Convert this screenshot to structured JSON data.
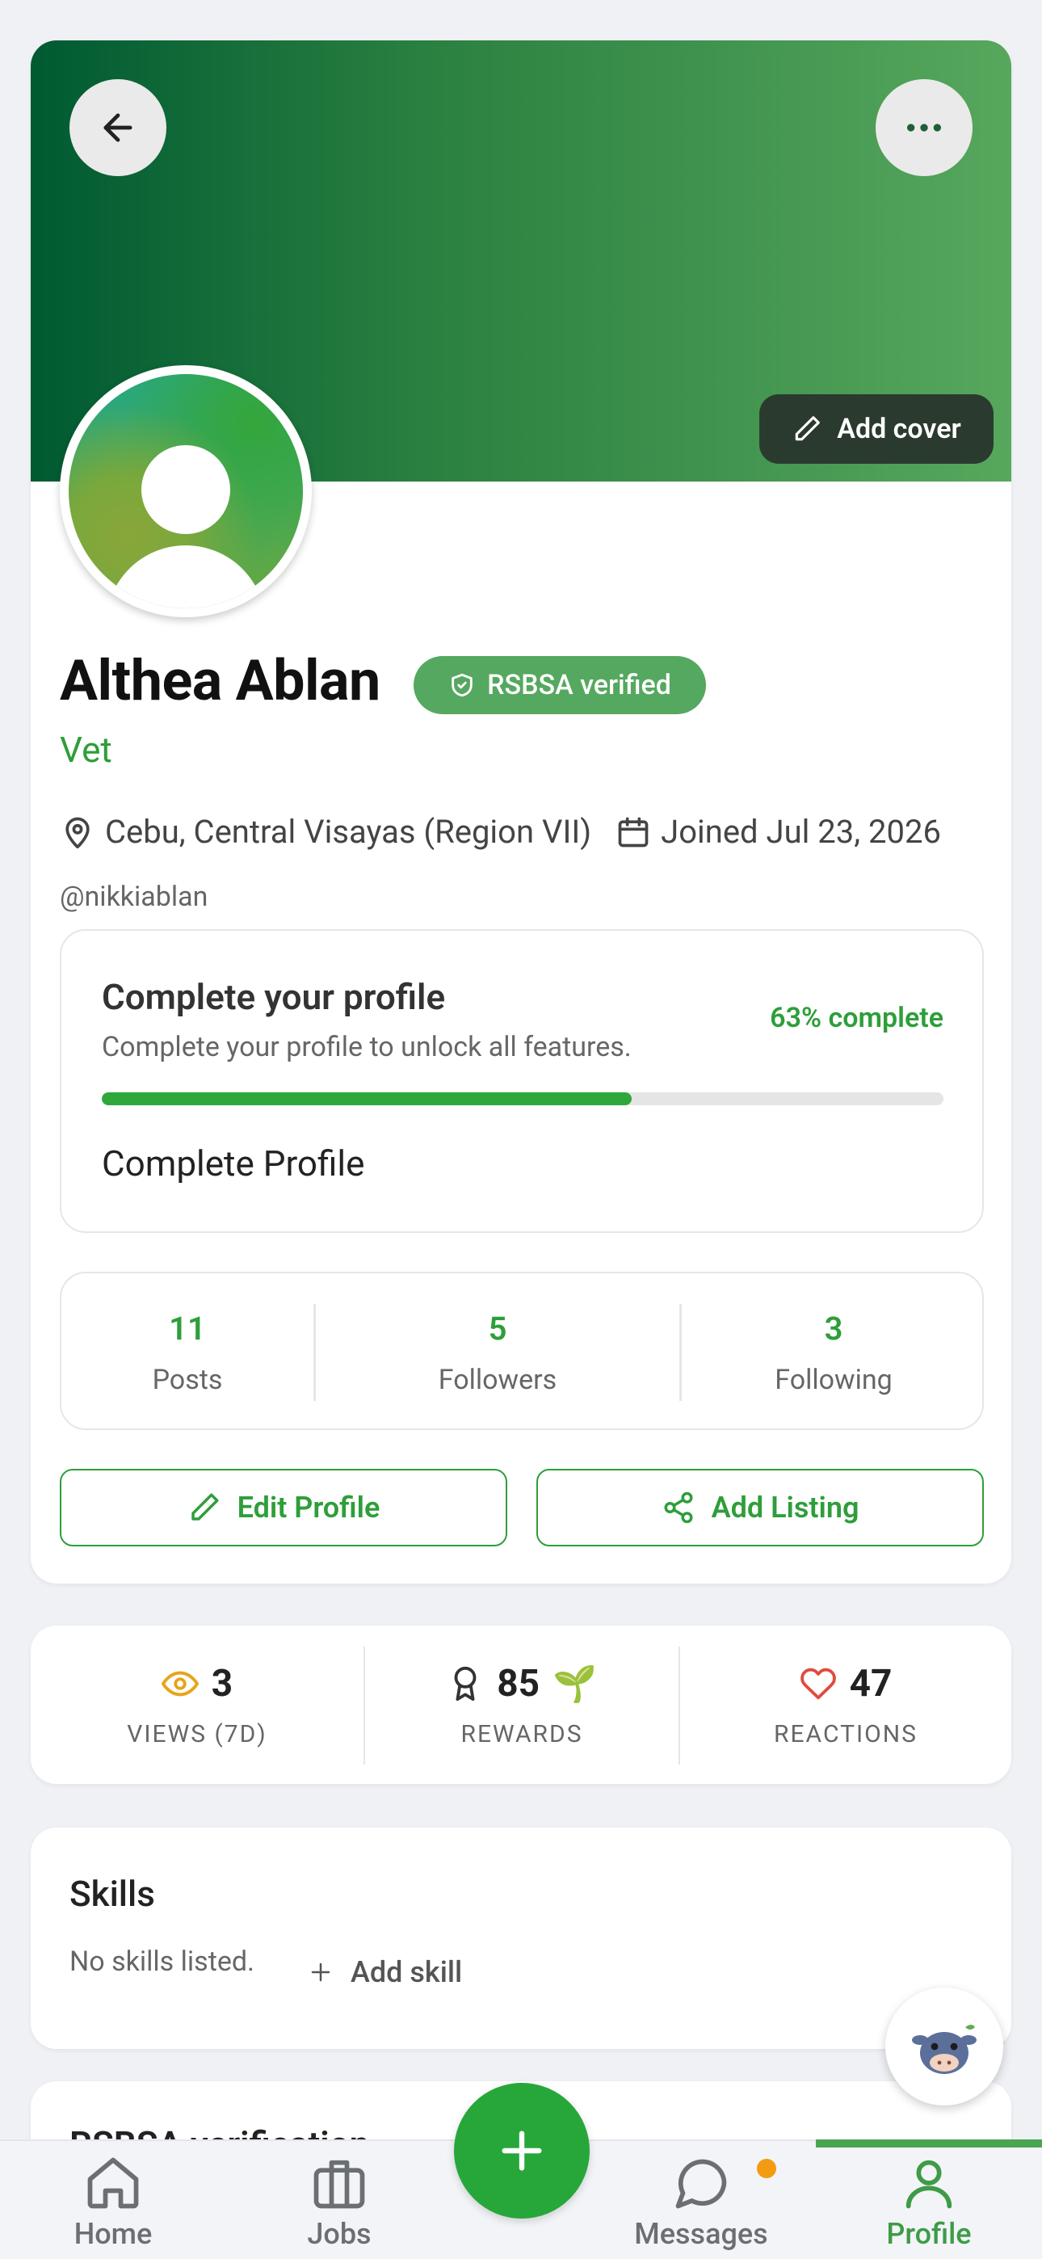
{
  "header": {
    "add_cover_label": "Add cover"
  },
  "profile": {
    "name": "Althea Ablan",
    "badge": "RSBSA verified",
    "role": "Vet",
    "location": "Cebu, Central Visayas (Region VII)",
    "joined": "Joined Jul 23, 2026",
    "handle": "@nikkiablan"
  },
  "completion": {
    "title": "Complete your profile",
    "subtitle": "Complete your profile to unlock all features.",
    "percent_label": "63% complete",
    "percent": 0.63,
    "link": "Complete Profile"
  },
  "stats": [
    {
      "value": "11",
      "label": "Posts"
    },
    {
      "value": "5",
      "label": "Followers"
    },
    {
      "value": "3",
      "label": "Following"
    }
  ],
  "actions": {
    "edit_label": "Edit Profile",
    "listing_label": "Add Listing"
  },
  "metrics": [
    {
      "value": "3",
      "label": "VIEWS (7D)",
      "icon": "eye-icon"
    },
    {
      "value": "85",
      "label": "REWARDS",
      "icon": "award-icon",
      "extra": "🌱"
    },
    {
      "value": "47",
      "label": "REACTIONS",
      "icon": "heart-icon"
    }
  ],
  "skills": {
    "title": "Skills",
    "empty": "No skills listed.",
    "add_label": "Add skill"
  },
  "next_section": {
    "title": "RSBSA verification"
  },
  "nav": {
    "items": [
      {
        "label": "Home",
        "icon": "home-icon"
      },
      {
        "label": "Jobs",
        "icon": "briefcase-icon"
      },
      {
        "label": "Messages",
        "icon": "chat-icon"
      },
      {
        "label": "Profile",
        "icon": "user-icon"
      }
    ],
    "active": "Profile"
  },
  "colors": {
    "brand_green": "#2e9e3a",
    "cover_dark": "#005a32",
    "cover_light": "#57a75d",
    "notification_dot": "#f39c12"
  }
}
